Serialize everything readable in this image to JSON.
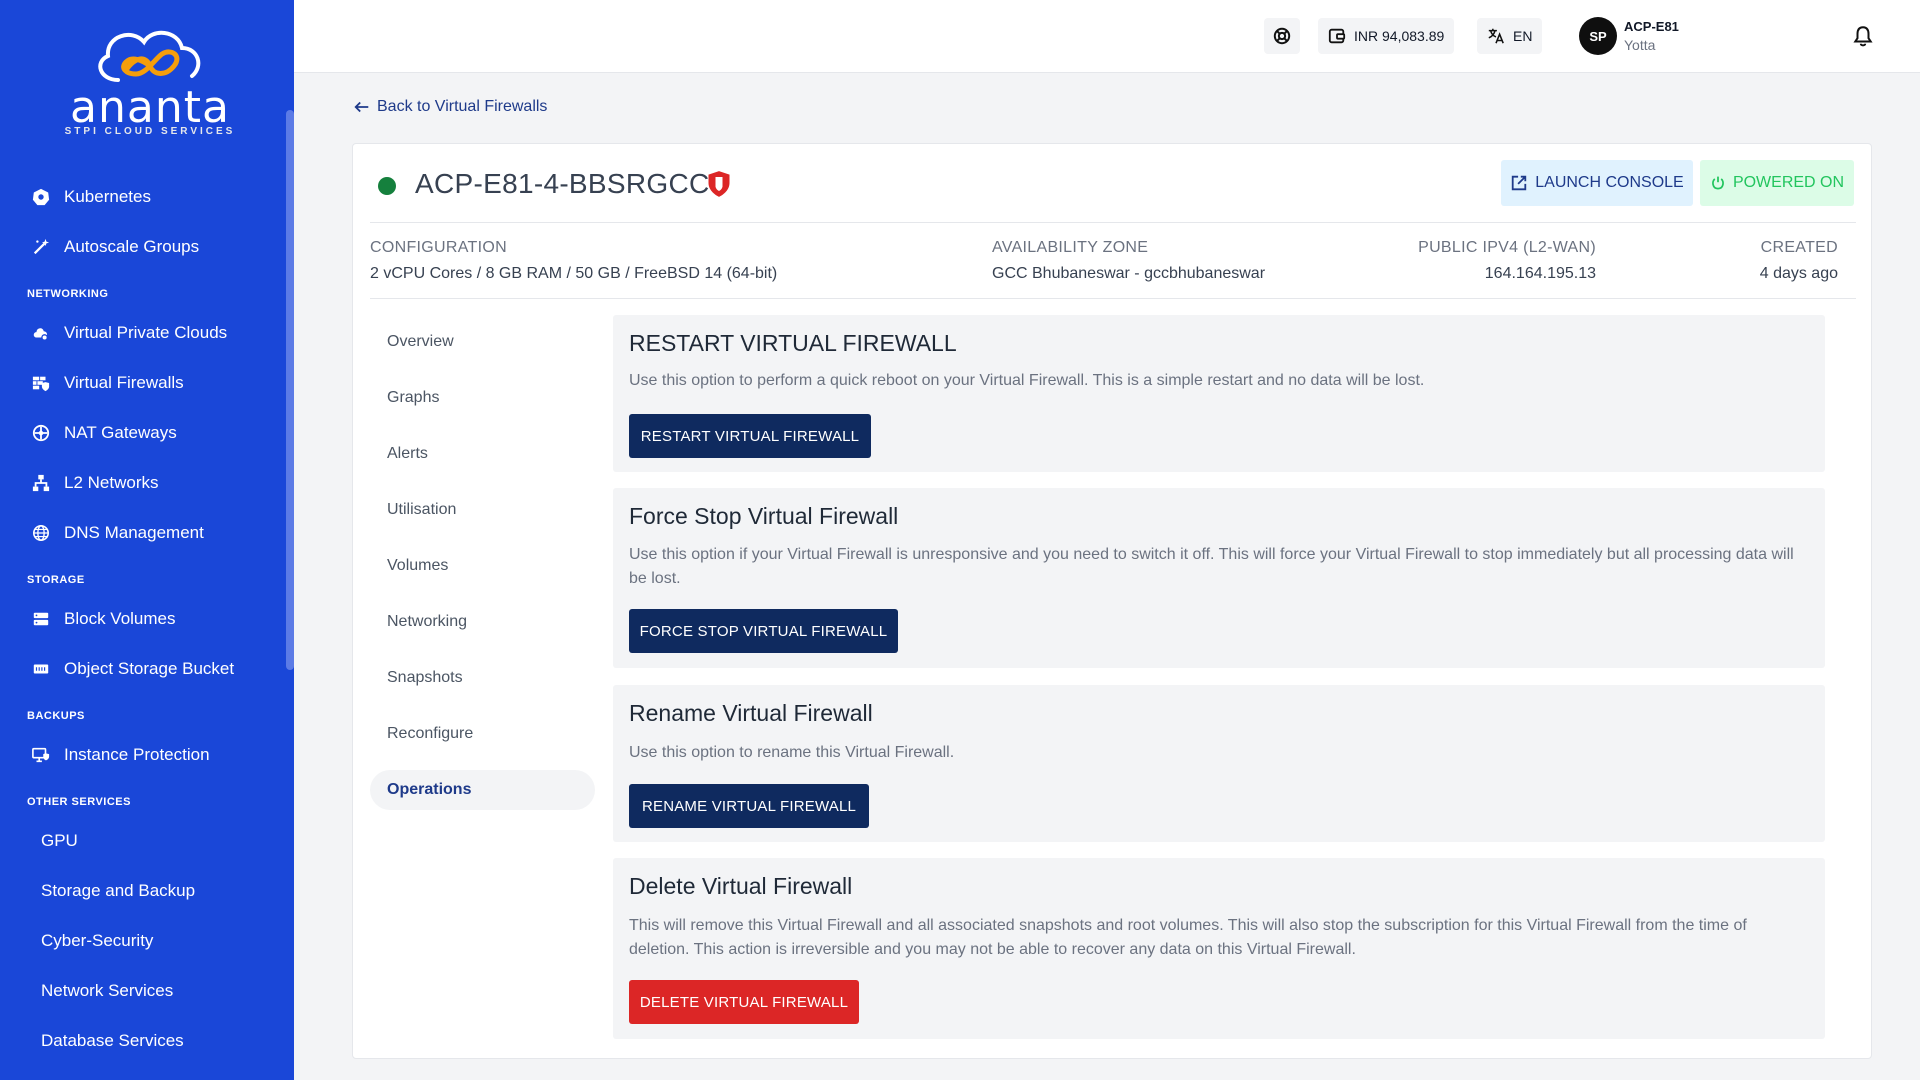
{
  "brand": {
    "name": "ananta",
    "tagline": "STPI CLOUD SERVICES",
    "accent": "#1a47d8"
  },
  "sidebar": {
    "items_top": [
      {
        "label": "Kubernetes",
        "icon": "kubernetes-icon"
      },
      {
        "label": "Autoscale Groups",
        "icon": "magic-wand-icon"
      }
    ],
    "sections": [
      {
        "title": "NETWORKING",
        "items": [
          {
            "label": "Virtual Private Clouds",
            "icon": "cloud-network-icon"
          },
          {
            "label": "Virtual Firewalls",
            "icon": "firewall-icon"
          },
          {
            "label": "NAT Gateways",
            "icon": "nat-gateway-icon"
          },
          {
            "label": "L2 Networks",
            "icon": "network-tree-icon"
          },
          {
            "label": "DNS Management",
            "icon": "globe-icon"
          }
        ]
      },
      {
        "title": "STORAGE",
        "items": [
          {
            "label": "Block Volumes",
            "icon": "block-volume-icon"
          },
          {
            "label": "Object Storage Bucket",
            "icon": "bucket-icon"
          }
        ]
      },
      {
        "title": "BACKUPS",
        "items": [
          {
            "label": "Instance Protection",
            "icon": "monitor-shield-icon"
          }
        ]
      },
      {
        "title": "OTHER SERVICES",
        "items": [
          {
            "label": "GPU"
          },
          {
            "label": "Storage and Backup"
          },
          {
            "label": "Cyber-Security"
          },
          {
            "label": "Network Services"
          },
          {
            "label": "Database Services"
          }
        ]
      }
    ]
  },
  "topbar": {
    "support_icon": "lifebuoy-icon",
    "balance": "INR 94,083.89",
    "language": "EN",
    "user_initials": "SP",
    "user_name": "ACP-E81",
    "user_org": "Yotta"
  },
  "back_link": "Back to Virtual Firewalls",
  "firewall": {
    "name": "ACP-E81-4-BBSRGCC",
    "status_color": "#15803d",
    "launch_console": "LAUNCH CONSOLE",
    "power_state": "POWERED ON",
    "meta": {
      "configuration_label": "CONFIGURATION",
      "configuration_value": "2 vCPU Cores / 8 GB RAM / 50 GB / FreeBSD 14 (64-bit)",
      "zone_label": "AVAILABILITY ZONE",
      "zone_value": "GCC Bhubaneswar - gccbhubaneswar",
      "ip_label": "PUBLIC IPV4 (L2-WAN)",
      "ip_value": "164.164.195.13",
      "created_label": "CREATED",
      "created_value": "4 days ago"
    }
  },
  "tabs": [
    "Overview",
    "Graphs",
    "Alerts",
    "Utilisation",
    "Volumes",
    "Networking",
    "Snapshots",
    "Reconfigure",
    "Operations"
  ],
  "active_tab": "Operations",
  "operations": {
    "restart": {
      "title": "RESTART VIRTUAL FIREWALL",
      "desc": "Use this option to perform a quick reboot on your Virtual Firewall. This is a simple restart and no data will be lost.",
      "button": "RESTART VIRTUAL FIREWALL"
    },
    "force_stop": {
      "title": "Force Stop Virtual Firewall",
      "desc": "Use this option if your Virtual Firewall is unresponsive and you need to switch it off. This will force your Virtual Firewall to stop immediately but all processing data will be lost.",
      "button": "FORCE STOP VIRTUAL FIREWALL"
    },
    "rename": {
      "title": "Rename Virtual Firewall",
      "desc": "Use this option to rename this Virtual Firewall.",
      "button": "RENAME VIRTUAL FIREWALL"
    },
    "delete": {
      "title": "Delete Virtual Firewall",
      "desc": "This will remove this Virtual Firewall and all associated snapshots and root volumes. This will also stop the subscription for this Virtual Firewall from the time of deletion. This action is irreversible and you may not be able to recover any data on this Virtual Firewall.",
      "button": "DELETE VIRTUAL FIREWALL"
    }
  }
}
